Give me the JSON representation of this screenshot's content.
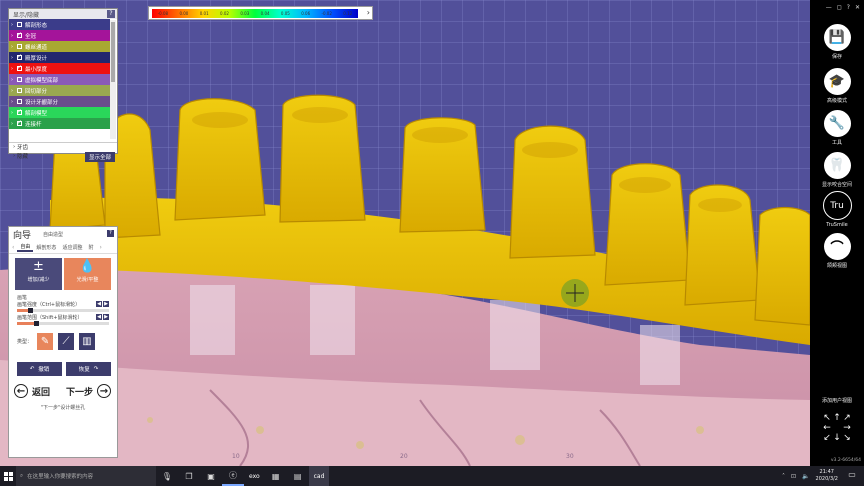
{
  "color_scale": {
    "ticks": [
      "-0.08",
      "0.00",
      "0.01",
      "0.02",
      "0.03",
      "0.04",
      "0.05",
      "0.06",
      "-0.02",
      "0.12"
    ],
    "menu_arrow": "›"
  },
  "layers": {
    "header": "显示/隐藏",
    "header_button": "?",
    "items": [
      {
        "label": "解剖形态",
        "color": "#3b3c8a",
        "checked": false
      },
      {
        "label": "全冠",
        "color": "#a4149a",
        "checked": true
      },
      {
        "label": "螺丝通道",
        "color": "#a8a832",
        "checked": false
      },
      {
        "label": "殿厚设计",
        "color": "#23276e",
        "checked": true
      },
      {
        "label": "最小厚度",
        "color": "#ee1111",
        "checked": true
      },
      {
        "label": "虚拟模型底部",
        "color": "#8a5ab8",
        "checked": false
      },
      {
        "label": "回切部分",
        "color": "#9aa850",
        "checked": false
      },
      {
        "label": "设计牙龈部分",
        "color": "#6a4c8c",
        "checked": false
      },
      {
        "label": "解剖模型",
        "color": "#2ad65a",
        "checked": true
      },
      {
        "label": "连接杆",
        "color": "#2aa14a",
        "checked": true
      }
    ],
    "group_label": "牙齿",
    "hide_label": "隐藏",
    "show_all": "显示全部"
  },
  "wizard": {
    "title": "向导",
    "subtitle": "自由造型",
    "help": "?",
    "tabs": [
      "自由",
      "解剖形态",
      "适应调整",
      "附"
    ],
    "tools": [
      {
        "label": "增加/减少",
        "symbol": "±",
        "color": "#4a4a7a"
      },
      {
        "label": "光滑/平整",
        "symbol": "💧",
        "color": "#e8865c"
      }
    ],
    "brush_heading": "画笔",
    "sliders": [
      {
        "label": "画笔强度（Ctrl+鼠标滑轮）",
        "value": 0.12
      },
      {
        "label": "画笔范围（Shift+鼠标滑轮）",
        "value": 0.18
      }
    ],
    "type_label": "类型：",
    "type_icons": [
      "brush-icon",
      "knife-icon",
      "cylinder-icon"
    ],
    "undo": "撤销",
    "redo": "恢复",
    "back": "返回",
    "next": "下一步",
    "note": "\"下一步\"设计螺丝孔"
  },
  "toolbar": {
    "top_icons": [
      "—",
      "◻",
      "?",
      "✕"
    ],
    "items": [
      {
        "label": "保存",
        "icon": "save-icon",
        "glyph": "💾"
      },
      {
        "label": "高级模式",
        "icon": "graduation-cap-icon",
        "glyph": "🎓"
      },
      {
        "label": "工具",
        "icon": "tools-icon",
        "glyph": "🔧"
      },
      {
        "label": "显示咬合空间",
        "icon": "tooth-icon",
        "glyph": "🦷"
      },
      {
        "label": "TruSmile",
        "icon": "trusmile-icon",
        "glyph": "Tru"
      },
      {
        "label": "颌颊视图",
        "icon": "jaw-view-icon",
        "glyph": "⌒"
      }
    ],
    "view_label": "添加用户视图",
    "version": "v3.2-6654/64"
  },
  "taskbar": {
    "search_placeholder": "在这里输入你要搜索的内容",
    "apps": [
      "exo",
      "cad"
    ],
    "time": "21:47",
    "date": "2020/3/2"
  }
}
